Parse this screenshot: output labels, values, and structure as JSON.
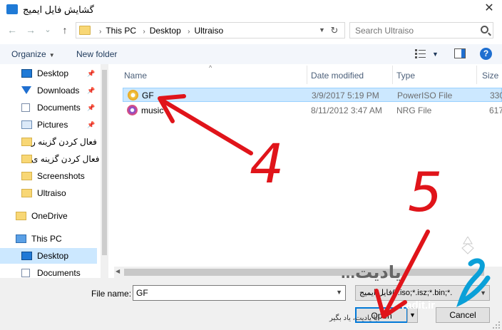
{
  "window": {
    "title": "گشایش فایل ایمیج",
    "close_glyph": "✕"
  },
  "nav": {
    "back_glyph": "←",
    "forward_glyph": "→",
    "recent_glyph": "⌄",
    "up_glyph": "↑",
    "refresh_glyph": "↻",
    "breadcrumb": [
      "This PC",
      "Desktop",
      "Ultraiso"
    ],
    "search_placeholder": "Search Ultraiso"
  },
  "toolbar": {
    "organize_label": "Organize",
    "new_folder_label": "New folder",
    "help_glyph": "?"
  },
  "sidebar": {
    "items": [
      {
        "label": "Desktop",
        "icon": "desktop-icon",
        "pinned": true
      },
      {
        "label": "Downloads",
        "icon": "download-icon",
        "pinned": true
      },
      {
        "label": "Documents",
        "icon": "documents-icon",
        "pinned": true
      },
      {
        "label": "Pictures",
        "icon": "pictures-icon",
        "pinned": true
      },
      {
        "label": "فعال کردن گزینه ر",
        "icon": "folder-icon",
        "pinned": false
      },
      {
        "label": "فعال کردن گزینه ی",
        "icon": "folder-icon",
        "pinned": false
      },
      {
        "label": "Screenshots",
        "icon": "folder-icon",
        "pinned": false
      },
      {
        "label": "Ultraiso",
        "icon": "folder-icon",
        "pinned": false
      },
      {
        "label": "OneDrive",
        "icon": "onedrive-icon",
        "pinned": false
      },
      {
        "label": "This PC",
        "icon": "this-pc-icon",
        "pinned": false
      },
      {
        "label": "Desktop",
        "icon": "desktop-icon",
        "pinned": false,
        "selected": true
      },
      {
        "label": "Documents",
        "icon": "documents-icon",
        "pinned": false
      }
    ],
    "pin_glyph": "📌"
  },
  "columns": {
    "name": "Name",
    "date": "Date modified",
    "type": "Type",
    "size": "Size"
  },
  "files": [
    {
      "name": "GF",
      "date": "3/9/2017 5:19 PM",
      "type": "PowerISO File",
      "size": "330",
      "selected": true,
      "icon": "poweriso-disc-icon"
    },
    {
      "name": "music",
      "date": "8/11/2012 3:47 AM",
      "type": "NRG File",
      "size": "617",
      "selected": false,
      "icon": "nrg-disc-icon"
    }
  ],
  "footer": {
    "file_name_label": "File name:",
    "file_name_value": "GF",
    "file_type_value": "فایل ایمیج(*.iso;*.isz;*.bin;*.",
    "open_label": "Open",
    "cancel_label": "Cancel"
  },
  "annotations": {
    "step_a": "4",
    "step_b": "5",
    "arrow_color": "#e0141a"
  },
  "watermark": {
    "brand": "یادیت...",
    "url": "Yadit.ir",
    "slogan": "با یادیت، یاد بگیر"
  }
}
